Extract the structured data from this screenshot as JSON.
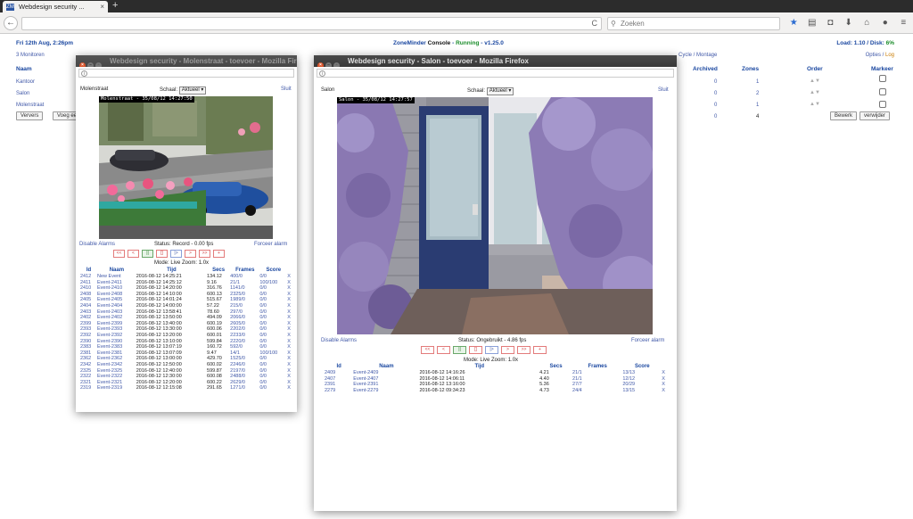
{
  "browser": {
    "tab_title": "Webdesign security ...",
    "tab_close": "×",
    "new_tab": "+",
    "back": "←",
    "reload": "C",
    "search_placeholder": "Zoeken",
    "search_icon": "search-icon",
    "toolbar_icons": [
      "star-icon",
      "clipboard-icon",
      "pocket-icon",
      "download-icon",
      "home-icon",
      "chat-icon",
      "menu-icon"
    ]
  },
  "console": {
    "date": "Fri 12th Aug, 2:26pm",
    "title_app": "ZoneMinder",
    "title_console": "Console",
    "title_state": "Running",
    "title_version": "v1.25.0",
    "load": "Load: 1.10 / Disk: ",
    "disk": "6%",
    "monitors_count": "3 Monitoren",
    "cycle": "Cycle / Montage",
    "options": "Opties / ",
    "log": "Log",
    "headers": {
      "name": "Naam",
      "archived": "Archived",
      "zones": "Zones",
      "order": "Order",
      "mark": "Markeer"
    },
    "monitors": [
      {
        "name": "Kantoor",
        "archived": "0",
        "zones": "1"
      },
      {
        "name": "Salon",
        "archived": "0",
        "zones": "2"
      },
      {
        "name": "Molenstraat",
        "archived": "0",
        "zones": "1"
      }
    ],
    "totals": {
      "archived": "0",
      "zones": "4"
    },
    "refresh_button": "Ververs",
    "add_button": "Voeg ee",
    "edit_button": "Bewerk",
    "delete_button": "verwijder"
  },
  "win1": {
    "title": "Webdesign security - Molenstraat - toevoer - Mozilla Firefox",
    "monitor": "Molenstraat",
    "scale_label": "Schaal:",
    "scale_value": "Aktueel",
    "close": "Sluit",
    "osd": "Molenstraat - 35/08/12 14:27:50",
    "disable_alarms": "Disable Alarms",
    "status": "Status: Record - 0.00 fps",
    "force_alarm": "Forceer alarm",
    "mode": "Mode: Live   Zoom: 1.0x",
    "controls": [
      "<<",
      "<",
      "||",
      "[]",
      "|>",
      ">",
      ">>",
      "+"
    ],
    "columns": [
      "Id",
      "Naam",
      "Tijd",
      "Secs",
      "Frames",
      "Score"
    ],
    "events": [
      [
        "2412",
        "New Event",
        "2016-08-12 14:25:21",
        "134.12",
        "400/0",
        "0/0"
      ],
      [
        "2411",
        "Event-2411",
        "2016-08-12 14:25:12",
        "9.16",
        "21/1",
        "100/100"
      ],
      [
        "2410",
        "Event-2410",
        "2016-08-12 14:20:00",
        "316.76",
        "1141/0",
        "0/0"
      ],
      [
        "2408",
        "Event-2408",
        "2016-08-12 14:10:00",
        "600.13",
        "2325/0",
        "0/0"
      ],
      [
        "2405",
        "Event-2405",
        "2016-08-12 14:01:24",
        "515.67",
        "1989/0",
        "0/0"
      ],
      [
        "2404",
        "Event-2404",
        "2016-08-12 14:00:00",
        "57.22",
        "215/0",
        "0/0"
      ],
      [
        "2403",
        "Event-2403",
        "2016-08-12 13:58:41",
        "78.60",
        "297/0",
        "0/0"
      ],
      [
        "2402",
        "Event-2402",
        "2016-08-12 13:50:00",
        "494.09",
        "2066/0",
        "0/0"
      ],
      [
        "2399",
        "Event-2399",
        "2016-08-12 13:40:00",
        "600.19",
        "2605/0",
        "0/0"
      ],
      [
        "2393",
        "Event-2393",
        "2016-08-12 13:30:00",
        "600.06",
        "2202/0",
        "0/0"
      ],
      [
        "2392",
        "Event-2392",
        "2016-08-12 13:20:00",
        "600.01",
        "2233/0",
        "0/0"
      ],
      [
        "2390",
        "Event-2390",
        "2016-08-12 13:10:00",
        "599.84",
        "2220/0",
        "0/0"
      ],
      [
        "2383",
        "Event-2383",
        "2016-08-12 13:07:19",
        "160.72",
        "592/0",
        "0/0"
      ],
      [
        "2381",
        "Event-2381",
        "2016-08-12 13:07:09",
        "9.47",
        "14/1",
        "100/100"
      ],
      [
        "2362",
        "Event-2362",
        "2016-08-12 13:00:00",
        "429.70",
        "1525/0",
        "0/0"
      ],
      [
        "2342",
        "Event-2342",
        "2016-08-12 12:50:00",
        "600.02",
        "2246/0",
        "0/0"
      ],
      [
        "2325",
        "Event-2325",
        "2016-08-12 12:40:00",
        "599.87",
        "2197/0",
        "0/0"
      ],
      [
        "2322",
        "Event-2322",
        "2016-08-12 12:30:00",
        "600.08",
        "2488/0",
        "0/0"
      ],
      [
        "2321",
        "Event-2321",
        "2016-08-12 12:20:00",
        "600.22",
        "2629/0",
        "0/0"
      ],
      [
        "2319",
        "Event-2319",
        "2016-08-12 12:15:08",
        "291.65",
        "1271/0",
        "0/0"
      ]
    ],
    "delete_mark": "X"
  },
  "win2": {
    "title": "Webdesign security - Salon - toevoer - Mozilla Firefox",
    "monitor": "Salon",
    "scale_label": "Schaal:",
    "scale_value": "Aktueel",
    "close": "Sluit",
    "osd": "Salon - 35/08/12 14:27:57",
    "disable_alarms": "Disable Alarms",
    "status": "Status: Ongebruikt - 4.86 fps",
    "force_alarm": "Forceer alarm",
    "mode": "Mode: Live   Zoom: 1.0x",
    "controls": [
      "<<",
      "<",
      "||",
      "[]",
      "|>",
      ">",
      ">>",
      "+"
    ],
    "columns": [
      "Id",
      "Naam",
      "Tijd",
      "Secs",
      "Frames",
      "Score"
    ],
    "events": [
      [
        "2409",
        "Event-2409",
        "2016-08-12 14:16:26",
        "4.21",
        "21/1",
        "13/13"
      ],
      [
        "2407",
        "Event-2407",
        "2016-08-12 14:06:11",
        "4.40",
        "21/1",
        "12/12"
      ],
      [
        "2391",
        "Event-2391",
        "2016-08-12 13:16:00",
        "5.36",
        "27/7",
        "20/29"
      ],
      [
        "2279",
        "Event-2279",
        "2016-08-12 09:34:23",
        "4.73",
        "24/4",
        "13/15"
      ]
    ],
    "delete_mark": "X"
  }
}
